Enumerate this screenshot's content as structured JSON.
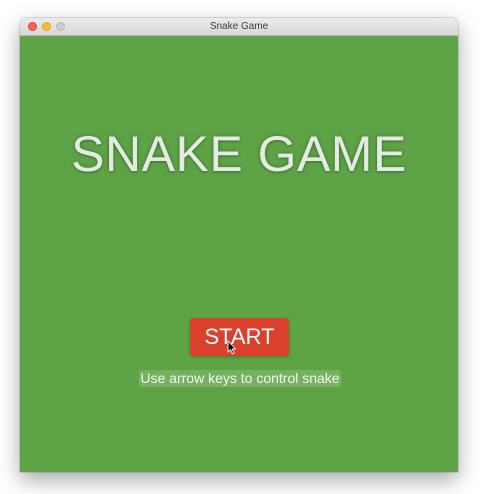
{
  "window": {
    "title": "Snake Game",
    "controls": [
      "close",
      "minimize",
      "maximize"
    ]
  },
  "game": {
    "title": "SNAKE GAME",
    "start_label": "START",
    "hint": "Use arrow keys to control snake",
    "colors": {
      "background": "#5ea446",
      "button": "#d9412d",
      "title_text": "#e3ece3"
    }
  },
  "icons": {
    "cursor": "arrow-pointer-icon"
  }
}
